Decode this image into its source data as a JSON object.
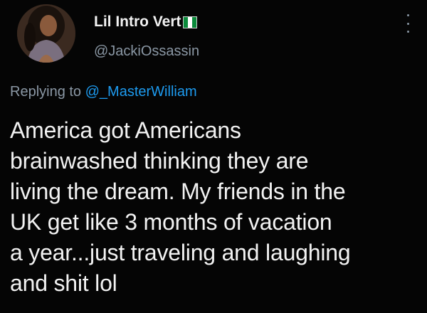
{
  "user": {
    "display_name": "Lil Intro Vert",
    "flag_icon": "nigeria-flag-icon",
    "username": "@JackiOssassin"
  },
  "reply": {
    "prefix": "Replying to ",
    "mention": "@_MasterWilliam"
  },
  "tweet": {
    "text": "America got Americans\nbrainwashed thinking they are\nliving the dream. My friends in the\nUK get like 3 months of vacation\na year...just traveling and laughing\nand shit lol"
  },
  "icons": {
    "more": "more-vertical-icon",
    "avatar": "profile-avatar"
  },
  "colors": {
    "background": "#050505",
    "text": "#f2f2f2",
    "secondary": "#8b98a5",
    "link": "#1d9bf0"
  }
}
